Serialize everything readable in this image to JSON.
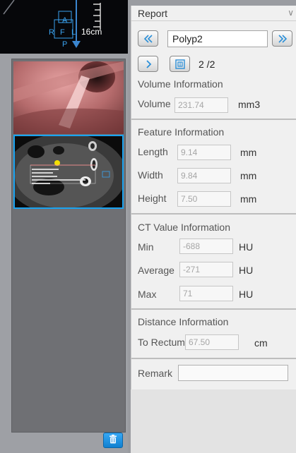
{
  "nav_view": {
    "orientation": {
      "a": "A",
      "r": "R",
      "f": "F",
      "l": "L",
      "p": "P"
    },
    "scale_label": "16cm"
  },
  "report": {
    "header": "Report",
    "polyp_name": "Polyp2",
    "page_counter": "2 /2",
    "volume": {
      "title": "Volume Information",
      "label": "Volume",
      "value": "231.74",
      "unit": "mm3"
    },
    "feature": {
      "title": "Feature Information",
      "rows": [
        {
          "label": "Length",
          "value": "9.14",
          "unit": "mm"
        },
        {
          "label": "Width",
          "value": "9.84",
          "unit": "mm"
        },
        {
          "label": "Height",
          "value": "7.50",
          "unit": "mm"
        }
      ]
    },
    "ct_value": {
      "title": "CT Value Information",
      "rows": [
        {
          "label": "Min",
          "value": "-688",
          "unit": "HU"
        },
        {
          "label": "Average",
          "value": "-271",
          "unit": "HU"
        },
        {
          "label": "Max",
          "value": "71",
          "unit": "HU"
        }
      ]
    },
    "distance": {
      "title": "Distance Information",
      "label": "To Rectum",
      "value": "67.50",
      "unit": "cm"
    },
    "remark": {
      "label": "Remark",
      "value": ""
    }
  },
  "icons": {
    "first": "double-chevron-left-icon",
    "last": "double-chevron-right-icon",
    "next": "chevron-right-icon",
    "capture": "capture-icon",
    "delete": "trash-icon",
    "collapse": "chevron-down-icon"
  },
  "colors": {
    "accent": "#1aa3f0",
    "panel_bg": "#f0f0f0",
    "nav_bg": "#06070a",
    "orientation_text": "#3aa2ee"
  }
}
